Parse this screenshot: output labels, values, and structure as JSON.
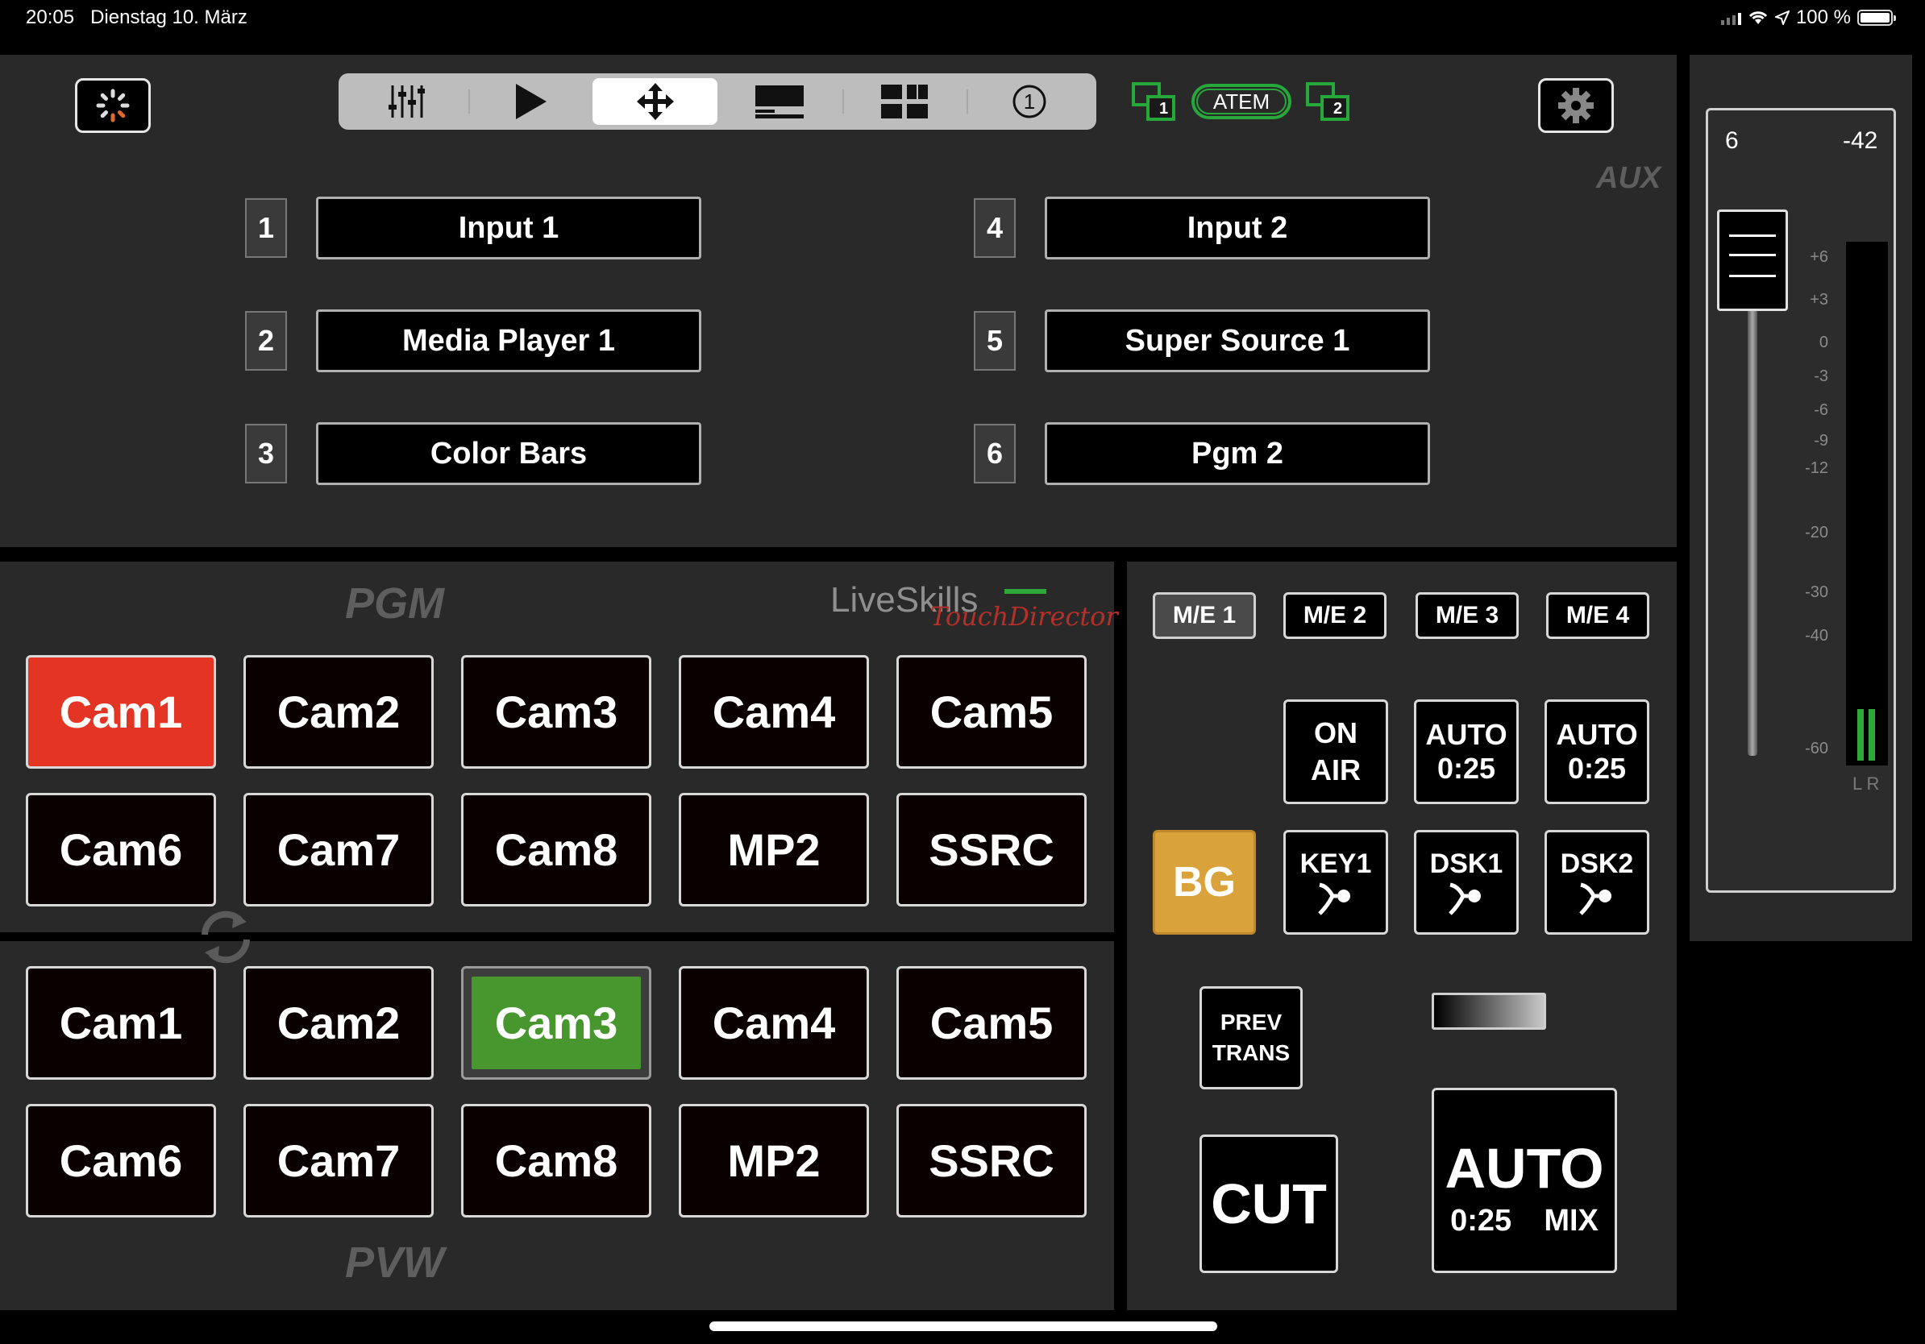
{
  "status_bar": {
    "time": "20:05",
    "date": "Dienstag 10. März",
    "battery": "100 %"
  },
  "toolbar": {
    "tabs": [
      {
        "icon": "mixer-faders-icon",
        "selected": false
      },
      {
        "icon": "play-icon",
        "selected": false
      },
      {
        "icon": "move-arrows-icon",
        "selected": true
      },
      {
        "icon": "lower-third-icon",
        "selected": false
      },
      {
        "icon": "multiview-icon",
        "selected": false
      },
      {
        "icon": "number-one-circle-icon",
        "selected": false
      }
    ],
    "atem_label": "ATEM",
    "atem_left_badge": "1",
    "atem_right_badge": "2"
  },
  "aux": {
    "label": "AUX",
    "items": [
      {
        "num": "1",
        "label": "Input 1"
      },
      {
        "num": "2",
        "label": "Media Player 1"
      },
      {
        "num": "3",
        "label": "Color Bars"
      },
      {
        "num": "4",
        "label": "Input 2"
      },
      {
        "num": "5",
        "label": "Super Source 1"
      },
      {
        "num": "6",
        "label": "Pgm 2"
      }
    ]
  },
  "pgm": {
    "label": "PGM",
    "logo_main": "LiveSkills",
    "logo_sub": "TouchDirector",
    "buttons": [
      "Cam1",
      "Cam2",
      "Cam3",
      "Cam4",
      "Cam5",
      "Cam6",
      "Cam7",
      "Cam8",
      "MP2",
      "SSRC"
    ],
    "active": "Cam1"
  },
  "pvw": {
    "label": "PVW",
    "buttons": [
      "Cam1",
      "Cam2",
      "Cam3",
      "Cam4",
      "Cam5",
      "Cam6",
      "Cam7",
      "Cam8",
      "MP2",
      "SSRC"
    ],
    "active": "Cam3"
  },
  "me": {
    "buttons": [
      "M/E 1",
      "M/E 2",
      "M/E 3",
      "M/E 4"
    ],
    "selected": "M/E 1"
  },
  "keys": {
    "on_air_1": "ON",
    "on_air_2": "AIR",
    "auto1_1": "AUTO",
    "auto1_2": "0:25",
    "auto2_1": "AUTO",
    "auto2_2": "0:25",
    "bg": "BG",
    "key1": "KEY1",
    "dsk1": "DSK1",
    "dsk2": "DSK2",
    "prev_1": "PREV",
    "prev_2": "TRANS",
    "cut": "CUT",
    "auto_big": "AUTO",
    "auto_time": "0:25",
    "auto_mix": "MIX"
  },
  "audio": {
    "fader_value": "6",
    "level_value": "-42",
    "scale": [
      "+6",
      "+3",
      "0",
      "-3",
      "-6",
      "-9",
      "-12",
      "-20",
      "-30",
      "-40",
      "-60"
    ],
    "lr": "L R",
    "meter_level_l": 0.1,
    "meter_level_r": 0.1
  },
  "colors": {
    "pgm_active": "#e43424",
    "pvw_active": "#48962e",
    "bg_button": "#d9a23a",
    "atem_green": "#27a83a"
  }
}
